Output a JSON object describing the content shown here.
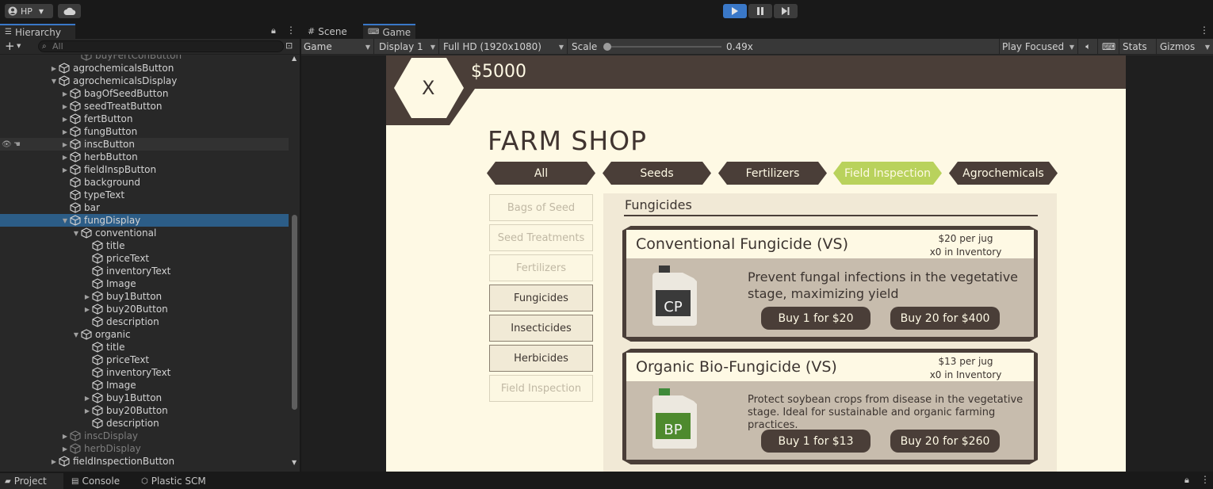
{
  "toolbar": {
    "account_label": "HP",
    "play_state": "playing"
  },
  "hierarchy": {
    "tab_label": "Hierarchy",
    "search_placeholder": "All",
    "rows": [
      {
        "label": "buyFertConButton",
        "indent": 3,
        "arrow": "",
        "dim": true
      },
      {
        "label": "agrochemicalsButton",
        "indent": 1,
        "arrow": "right",
        "dim": false
      },
      {
        "label": "agrochemicalsDisplay",
        "indent": 1,
        "arrow": "down",
        "dim": false
      },
      {
        "label": "bagOfSeedButton",
        "indent": 2,
        "arrow": "right",
        "dim": false
      },
      {
        "label": "seedTreatButton",
        "indent": 2,
        "arrow": "right",
        "dim": false
      },
      {
        "label": "fertButton",
        "indent": 2,
        "arrow": "right",
        "dim": false
      },
      {
        "label": "fungButton",
        "indent": 2,
        "arrow": "right",
        "dim": false
      },
      {
        "label": "inscButton",
        "indent": 2,
        "arrow": "right",
        "dim": false,
        "hover": true
      },
      {
        "label": "herbButton",
        "indent": 2,
        "arrow": "right",
        "dim": false
      },
      {
        "label": "fieldInspButton",
        "indent": 2,
        "arrow": "right",
        "dim": false
      },
      {
        "label": "background",
        "indent": 2,
        "arrow": "",
        "dim": false
      },
      {
        "label": "typeText",
        "indent": 2,
        "arrow": "",
        "dim": false
      },
      {
        "label": "bar",
        "indent": 2,
        "arrow": "",
        "dim": false
      },
      {
        "label": "fungDisplay",
        "indent": 2,
        "arrow": "down",
        "dim": false,
        "selected": true
      },
      {
        "label": "conventional",
        "indent": 3,
        "arrow": "down",
        "dim": false
      },
      {
        "label": "title",
        "indent": 4,
        "arrow": "",
        "dim": false
      },
      {
        "label": "priceText",
        "indent": 4,
        "arrow": "",
        "dim": false
      },
      {
        "label": "inventoryText",
        "indent": 4,
        "arrow": "",
        "dim": false
      },
      {
        "label": "Image",
        "indent": 4,
        "arrow": "",
        "dim": false
      },
      {
        "label": "buy1Button",
        "indent": 4,
        "arrow": "right",
        "dim": false
      },
      {
        "label": "buy20Button",
        "indent": 4,
        "arrow": "right",
        "dim": false
      },
      {
        "label": "description",
        "indent": 4,
        "arrow": "",
        "dim": false
      },
      {
        "label": "organic",
        "indent": 3,
        "arrow": "down",
        "dim": false
      },
      {
        "label": "title",
        "indent": 4,
        "arrow": "",
        "dim": false
      },
      {
        "label": "priceText",
        "indent": 4,
        "arrow": "",
        "dim": false
      },
      {
        "label": "inventoryText",
        "indent": 4,
        "arrow": "",
        "dim": false
      },
      {
        "label": "Image",
        "indent": 4,
        "arrow": "",
        "dim": false
      },
      {
        "label": "buy1Button",
        "indent": 4,
        "arrow": "right",
        "dim": false
      },
      {
        "label": "buy20Button",
        "indent": 4,
        "arrow": "right",
        "dim": false
      },
      {
        "label": "description",
        "indent": 4,
        "arrow": "",
        "dim": false
      },
      {
        "label": "inscDisplay",
        "indent": 2,
        "arrow": "right",
        "dim": true
      },
      {
        "label": "herbDisplay",
        "indent": 2,
        "arrow": "right",
        "dim": true
      },
      {
        "label": "fieldInspectionButton",
        "indent": 1,
        "arrow": "right",
        "dim": false
      }
    ]
  },
  "game_view": {
    "scene_tab": "Scene",
    "game_tab": "Game",
    "mode": "Game",
    "display": "Display 1",
    "resolution": "Full HD (1920x1080)",
    "scale_label": "Scale",
    "scale_value": "0.49x",
    "play_focus": "Play Focused",
    "stats": "Stats",
    "gizmos": "Gizmos"
  },
  "shop": {
    "close_label": "X",
    "money": "$5000",
    "title": "FARM SHOP",
    "categories": [
      {
        "label": "All",
        "active": false
      },
      {
        "label": "Seeds",
        "active": false
      },
      {
        "label": "Fertilizers",
        "active": false
      },
      {
        "label": "Field Inspection",
        "active": true
      },
      {
        "label": "Agrochemicals",
        "active": false
      }
    ],
    "sidebar": [
      {
        "label": "Bags of Seed",
        "enabled": false
      },
      {
        "label": "Seed Treatments",
        "enabled": false
      },
      {
        "label": "Fertilizers",
        "enabled": false
      },
      {
        "label": "Fungicides",
        "enabled": true
      },
      {
        "label": "Insecticides",
        "enabled": true
      },
      {
        "label": "Herbicides",
        "enabled": true
      },
      {
        "label": "Field Inspection",
        "enabled": false
      }
    ],
    "section_title": "Fungicides",
    "products": [
      {
        "title": "Conventional Fungicide (VS)",
        "price": "$20 per jug",
        "inventory": "x0 in Inventory",
        "description": "Prevent fungal infections in the vegetative stage, maximizing yield",
        "jug_label": "CP",
        "jug_cap_color": "#3a3a3a",
        "jug_label_color": "#3a3a3a",
        "buy1": "Buy 1 for $20",
        "buy20": "Buy 20 for $400"
      },
      {
        "title": "Organic Bio-Fungicide (VS)",
        "price": "$13 per jug",
        "inventory": "x0 in Inventory",
        "description": "Protect soybean crops from disease in the vegetative stage. Ideal for sustainable and organic farming practices.",
        "jug_label": "BP",
        "jug_cap_color": "#3f8a3a",
        "jug_label_color": "#4e8a2e",
        "buy1": "Buy 1 for $13",
        "buy20": "Buy 20 for $260"
      }
    ]
  },
  "bottom_tabs": {
    "project": "Project",
    "console": "Console",
    "plastic": "Plastic SCM"
  }
}
